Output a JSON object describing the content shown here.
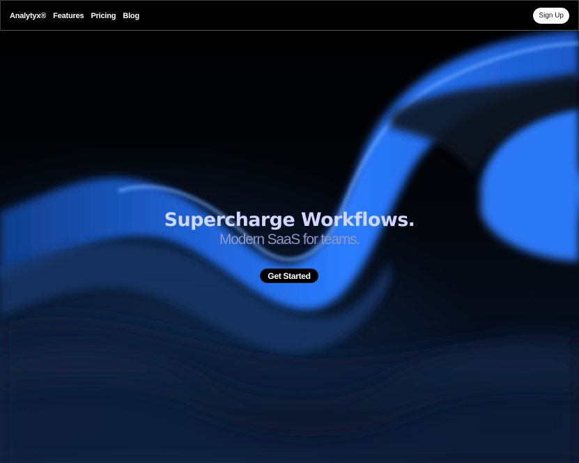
{
  "nav": {
    "brand": "Analytyx®",
    "links": [
      "Features",
      "Pricing",
      "Blog"
    ],
    "signup_label": "Sign Up"
  },
  "hero": {
    "title": "Supercharge Workflows.",
    "subtitle": "Modern SaaS for teams.",
    "cta_label": "Get Started"
  },
  "colors": {
    "accent_blue": "#2f7bff",
    "title": "#cfd6ff",
    "subtitle": "#8d97c6",
    "background": "#000000"
  }
}
